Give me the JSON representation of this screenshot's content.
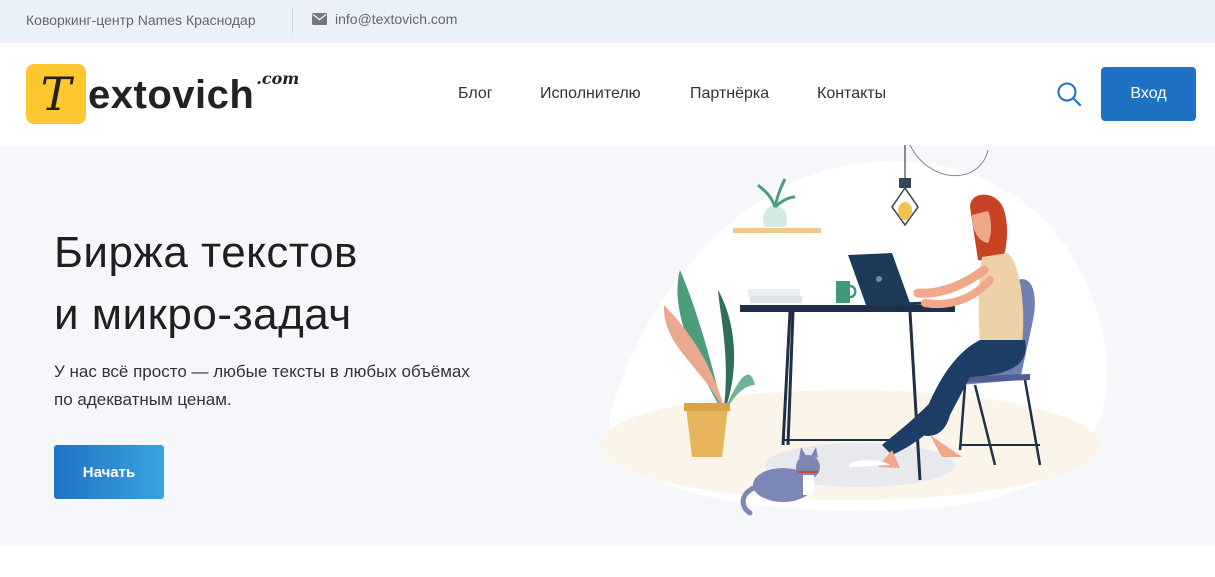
{
  "topbar": {
    "location": "Коворкинг-центр Names Краснодар",
    "email": "info@textovich.com"
  },
  "header": {
    "logo_letter": "T",
    "logo_word": "extovich",
    "logo_suffix": ".com",
    "nav": [
      "Блог",
      "Исполнителю",
      "Партнёрка",
      "Контакты"
    ],
    "login_label": "Вход"
  },
  "hero": {
    "title_line1": "Биржа текстов",
    "title_line2": "и микро-задач",
    "subtitle_line1": "У нас всё просто — любые тексты в любых объёмах",
    "subtitle_line2": "по адекватным ценам.",
    "cta_label": "Начать"
  },
  "colors": {
    "topbar_bg": "#eaf1fb",
    "logo_yellow": "#fdc82f",
    "primary_blue": "#1f72c3",
    "hero_bg": "#f6f7fb"
  }
}
